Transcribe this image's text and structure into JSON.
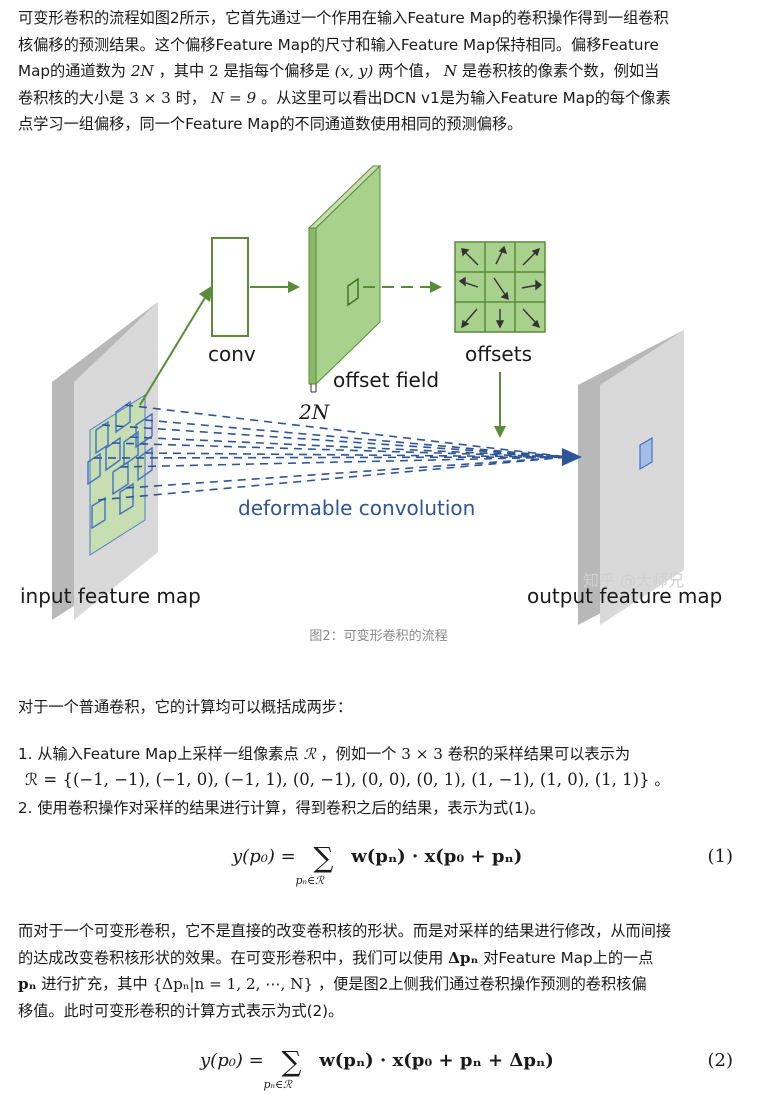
{
  "para1": {
    "l1": "可变形卷积的流程如图2所示，它首先通过一个作用在输入Feature Map的卷积操作得到一组卷积",
    "l2": "核偏移的预测结果。这个偏移Feature Map的尺寸和输入Feature Map保持相同。偏移Feature",
    "l3a": "Map的通道数为",
    "l3m1": "2N",
    "l3b": "，其中",
    "l3m2": "2",
    "l3c": "是指每个偏移是",
    "l3m3": "(x, y)",
    "l3d": "两个值，",
    "l3m4": "N",
    "l3e": "是卷积核的像素个数，例如当",
    "l4a": "卷积核的大小是",
    "l4m1": "3 × 3",
    "l4b": "时，",
    "l4m2": "N = 9",
    "l4c": "。从这里可以看出DCN v1是为输入Feature Map的每个像素",
    "l5": "点学习一组偏移，同一个Feature Map的不同通道数使用相同的预测偏移。"
  },
  "figure": {
    "conv_label": "conv",
    "offset_field_label": "offset field",
    "offsets_label": "offsets",
    "channels_label": "2N",
    "deformable_label": "deformable convolution",
    "input_label": "input feature map",
    "output_label": "output feature map",
    "watermark": "知乎 @大师兄",
    "colors": {
      "green": "#5b8c3a",
      "light_green": "#a9d18e",
      "blue": "#4472c4",
      "dash_blue": "#2e5597",
      "gray": "#c8c8c8"
    }
  },
  "caption": "图2：可变形卷积的流程",
  "para2": "对于一个普通卷积，它的计算均可以概括成两步：",
  "list": {
    "i1a": "1. 从输入Feature Map上采样一组像素点",
    "i1m": "ℛ",
    "i1b": "，例如一个",
    "i1m2": "3 × 3",
    "i1c": "卷积的采样结果可以表示为",
    "i1set": "ℛ = {(−1, −1), (−1, 0), (−1, 1), (0, −1), (0, 0), (0, 1), (1, −1), (1, 0), (1, 1)}",
    "i1end": "。",
    "i2": "2. 使用卷积操作对采样的结果进行计算，得到卷积之后的结果，表示为式(1)。"
  },
  "eq1": {
    "lhs": "y(p₀) =",
    "sub": "pₙ∈ℛ",
    "rhs": "w(pₙ) · x(p₀ + pₙ)",
    "num": "(1)"
  },
  "para3": {
    "l1": "而对于一个可变形卷积，它不是直接的改变卷积核的形状。而是对采样的结果进行修改，从而间接",
    "l2a": "的达成改变卷积核形状的效果。在可变形卷积中，我们可以使用",
    "l2m": "Δpₙ",
    "l2b": "对Feature Map上的一点",
    "l3m1": "pₙ",
    "l3a": "进行扩充，其中",
    "l3m2": "{Δpₙ|n = 1, 2, ⋯, N}",
    "l3b": "，便是图2上侧我们通过卷积操作预测的卷积核偏",
    "l4": "移值。此时可变形卷积的计算方式表示为式(2)。"
  },
  "eq2": {
    "lhs": "y(p₀) =",
    "sub": "pₙ∈ℛ",
    "rhs": "w(pₙ) · x(p₀ + pₙ + Δpₙ)",
    "num": "(2)"
  }
}
